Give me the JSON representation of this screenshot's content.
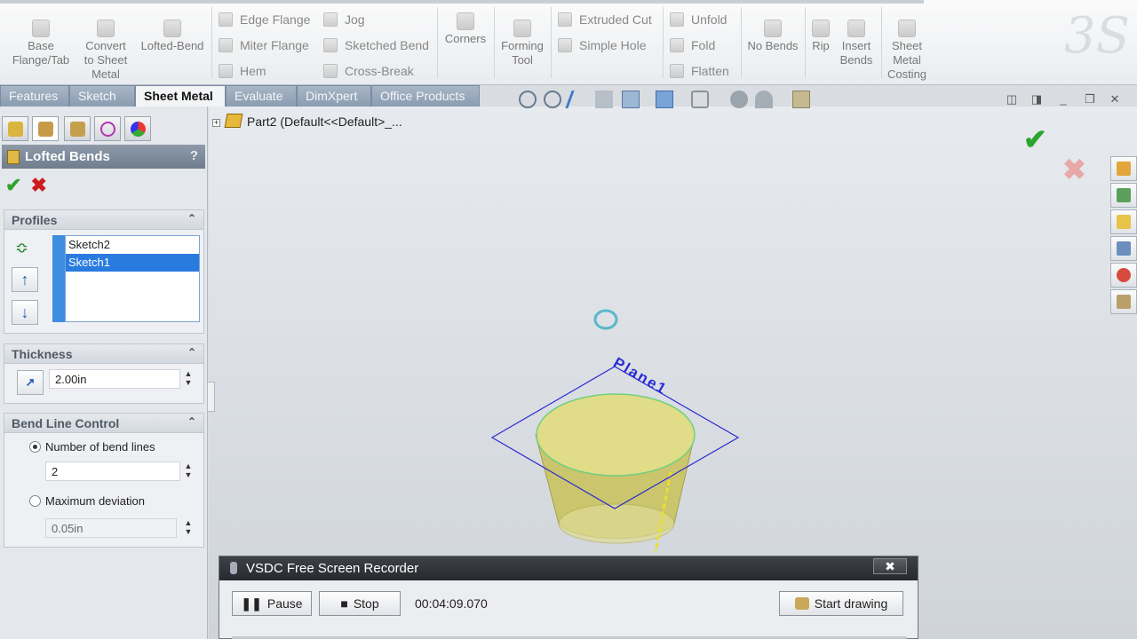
{
  "ribbon": {
    "base_flange": "Base\nFlange/Tab",
    "convert": "Convert\nto Sheet\nMetal",
    "lofted_bend": "Lofted-Bend",
    "edge_flange": "Edge Flange",
    "miter_flange": "Miter Flange",
    "hem": "Hem",
    "jog": "Jog",
    "sketched_bend": "Sketched Bend",
    "cross_break": "Cross-Break",
    "corners": "Corners",
    "forming_tool": "Forming\nTool",
    "extruded_cut": "Extruded Cut",
    "simple_hole": "Simple Hole",
    "unfold": "Unfold",
    "fold": "Fold",
    "flatten": "Flatten",
    "no_bends": "No Bends",
    "rip": "Rip",
    "insert_bends": "Insert\nBends",
    "sheet_metal_costing": "Sheet\nMetal\nCosting"
  },
  "tabs": [
    "Features",
    "Sketch",
    "Sheet Metal",
    "Evaluate",
    "DimXpert",
    "Office Products"
  ],
  "active_tab": "Sheet Metal",
  "panel": {
    "title": "Lofted Bends",
    "help": "?",
    "ok_glyph": "✔",
    "cancel_glyph": "✖",
    "profiles": {
      "heading": "Profiles",
      "items": [
        "Sketch2",
        "Sketch1"
      ],
      "selected": "Sketch1"
    },
    "thickness": {
      "heading": "Thickness",
      "value": "2.00in"
    },
    "bend_line_control": {
      "heading": "Bend Line Control",
      "option1": "Number of bend lines",
      "option1_value": "2",
      "option2": "Maximum deviation",
      "option2_value": "0.05in"
    }
  },
  "tree": {
    "node": "Part2  (Default<<Default>_..."
  },
  "model": {
    "plane_label": "Plane1"
  },
  "recorder": {
    "title": "VSDC Free Screen Recorder",
    "pause": "Pause",
    "stop": "Stop",
    "time": "00:04:09.070",
    "start_drawing": "Start drawing",
    "close": "✖"
  },
  "colors": {
    "ok": "#2fa32f",
    "cancel": "#cc1e1e",
    "selection": "#2a7be0",
    "model_fill": "#d6d37a",
    "plane": "#2b2bd0"
  }
}
